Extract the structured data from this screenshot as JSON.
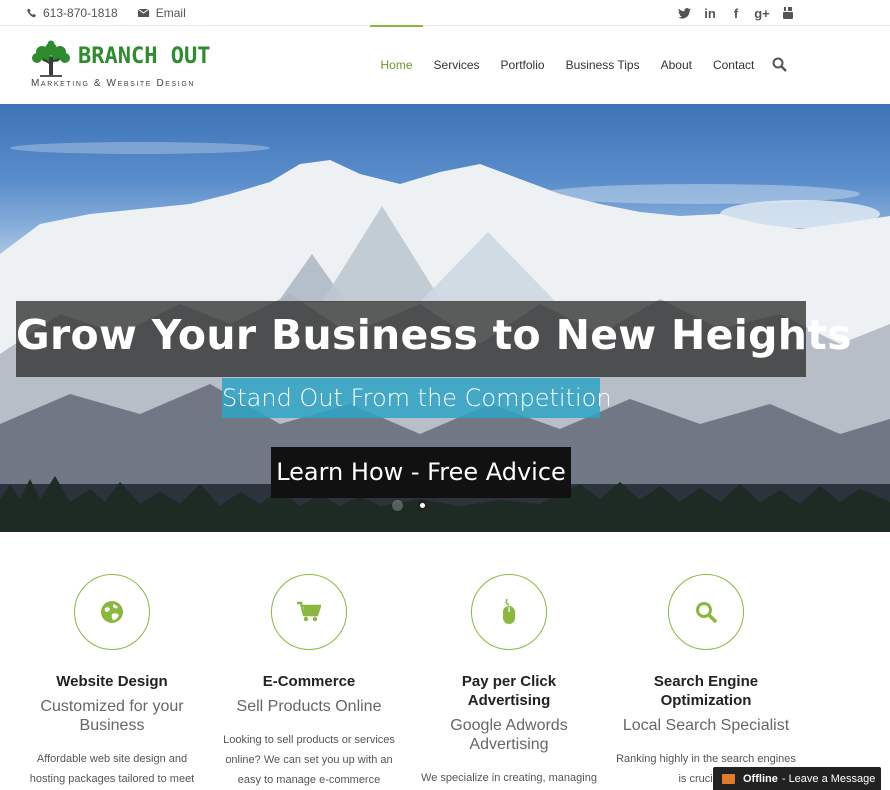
{
  "topbar": {
    "phone": "613-870-1818",
    "email_label": "Email",
    "social": [
      "twitter-icon",
      "linkedin-icon",
      "facebook-icon",
      "google-plus-icon",
      "youtube-icon"
    ]
  },
  "logo": {
    "brand": "BRANCH OUT",
    "tagline": "Marketing & Website Design"
  },
  "nav": {
    "items": [
      "Home",
      "Services",
      "Portfolio",
      "Business Tips",
      "About",
      "Contact"
    ],
    "active": "Home"
  },
  "hero": {
    "headline": "Grow Your Business to New Heights",
    "subline": "Stand Out From the Competition",
    "cta": "Learn How - Free Advice",
    "slides_count": 2,
    "active_slide": 2
  },
  "services": [
    {
      "icon": "globe-icon",
      "title": "Website Design",
      "sub": "Customized for your Business",
      "desc": "Affordable web site design and hosting packages tailored to meet"
    },
    {
      "icon": "cart-icon",
      "title": "E-Commerce",
      "sub": "Sell Products Online",
      "desc": "Looking to sell products or services online?  We can set you up with an easy to manage e-commerce"
    },
    {
      "icon": "mouse-icon",
      "title": "Pay per Click Advertising",
      "sub": "Google Adwords Advertising",
      "desc": "We specialize in creating, managing"
    },
    {
      "icon": "search-icon",
      "title": "Search Engine Optimization",
      "sub": "Local Search Specialist",
      "desc": "Ranking highly in the search engines is crucial to"
    }
  ],
  "chat": {
    "status": "Offline",
    "message": "- Leave a Message"
  },
  "colors": {
    "accent": "#8ab83e",
    "brand_green": "#2e8b2e",
    "subline_bg": "#2ea4c4"
  }
}
